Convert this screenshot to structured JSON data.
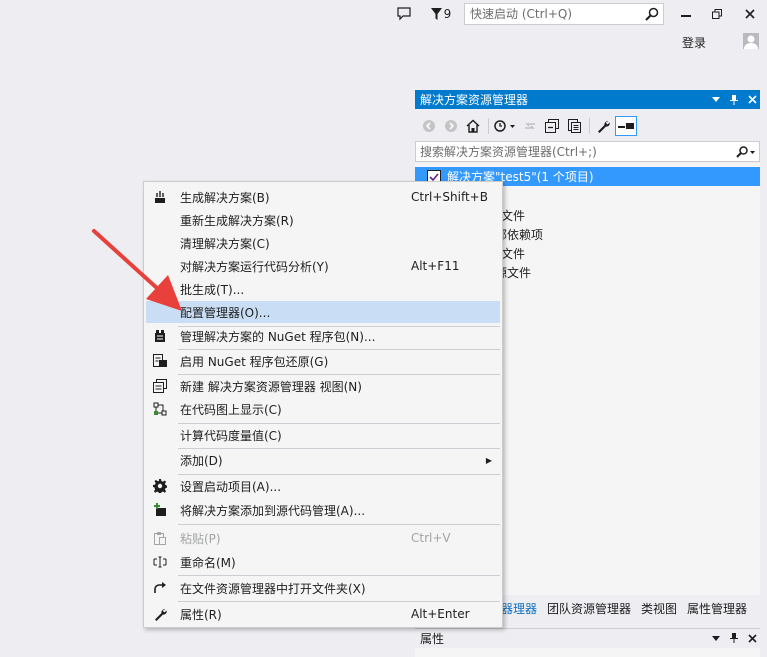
{
  "titlebar": {
    "notification_icon": "speech-bubble-icon",
    "filter_count": "9",
    "quick_launch_placeholder": "快速启动 (Ctrl+Q)",
    "login_label": "登录"
  },
  "solution_explorer": {
    "title": "解决方案资源管理器",
    "search_placeholder": "搜索解决方案资源管理器(Ctrl+;)",
    "tree": [
      {
        "label": "解决方案\"test5\"(1 个项目)",
        "selected": true
      },
      {
        "label": "文件"
      },
      {
        "label": "部依赖项"
      },
      {
        "label": "文件"
      },
      {
        "label": "源文件"
      }
    ]
  },
  "bottom_tabs": [
    {
      "label": "器理器",
      "active": true
    },
    {
      "label": "团队资源管理器"
    },
    {
      "label": "类视图"
    },
    {
      "label": "属性管理器"
    }
  ],
  "properties": {
    "title": "属性"
  },
  "context_menu": {
    "items": [
      {
        "label": "生成解决方案(B)",
        "shortcut": "Ctrl+Shift+B",
        "icon": "build-icon"
      },
      {
        "label": "重新生成解决方案(R)",
        "shortcut": ""
      },
      {
        "label": "清理解决方案(C)",
        "shortcut": ""
      },
      {
        "label": "对解决方案运行代码分析(Y)",
        "shortcut": "Alt+F11"
      },
      {
        "label": "批生成(T)...",
        "shortcut": ""
      },
      {
        "label": "配置管理器(O)...",
        "shortcut": "",
        "highlighted": true
      },
      {
        "label": "管理解决方案的 NuGet 程序包(N)...",
        "shortcut": "",
        "icon": "nuget-icon"
      },
      {
        "label": "启用 NuGet 程序包还原(G)",
        "shortcut": "",
        "icon": "package-restore-icon"
      },
      {
        "label": "新建 解决方案资源管理器 视图(N)",
        "shortcut": "",
        "icon": "new-view-icon"
      },
      {
        "label": "在代码图上显示(C)",
        "shortcut": "",
        "icon": "code-map-icon"
      },
      {
        "label": "计算代码度量值(C)",
        "shortcut": ""
      },
      {
        "label": "添加(D)",
        "shortcut": "",
        "submenu": true
      },
      {
        "label": "设置启动项目(A)...",
        "shortcut": "",
        "icon": "gear-icon"
      },
      {
        "label": "将解决方案添加到源代码管理(A)...",
        "shortcut": "",
        "icon": "source-control-add-icon"
      },
      {
        "label": "粘贴(P)",
        "shortcut": "Ctrl+V",
        "icon": "paste-icon",
        "disabled": true
      },
      {
        "label": "重命名(M)",
        "shortcut": "",
        "icon": "rename-icon"
      },
      {
        "label": "在文件资源管理器中打开文件夹(X)",
        "shortcut": "",
        "icon": "open-folder-arrow-icon"
      },
      {
        "label": "属性(R)",
        "shortcut": "Alt+Enter",
        "icon": "wrench-icon"
      }
    ]
  },
  "colors": {
    "accent": "#007acc",
    "selection": "#3399ff",
    "menu_highlight": "#c9def5",
    "annotation_arrow": "#e8403a"
  }
}
